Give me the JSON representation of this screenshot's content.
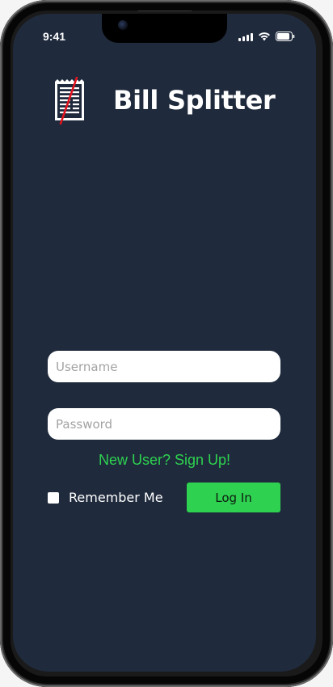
{
  "status_bar": {
    "time": "9:41",
    "icons": [
      "cellular-signal-icon",
      "wifi-icon",
      "battery-icon"
    ]
  },
  "app": {
    "title": "Bill Splitter",
    "logo_icon": "receipt-icon"
  },
  "form": {
    "username_placeholder": "Username",
    "username_value": "",
    "password_placeholder": "Password",
    "password_value": "",
    "signup_link": "New User? Sign Up!",
    "remember_label": "Remember Me",
    "remember_checked": false,
    "login_label": "Log In"
  },
  "colors": {
    "background": "#1f2a3c",
    "accent_green": "#2ed250",
    "logo_strike": "#e0141e",
    "text_white": "#ffffff"
  }
}
